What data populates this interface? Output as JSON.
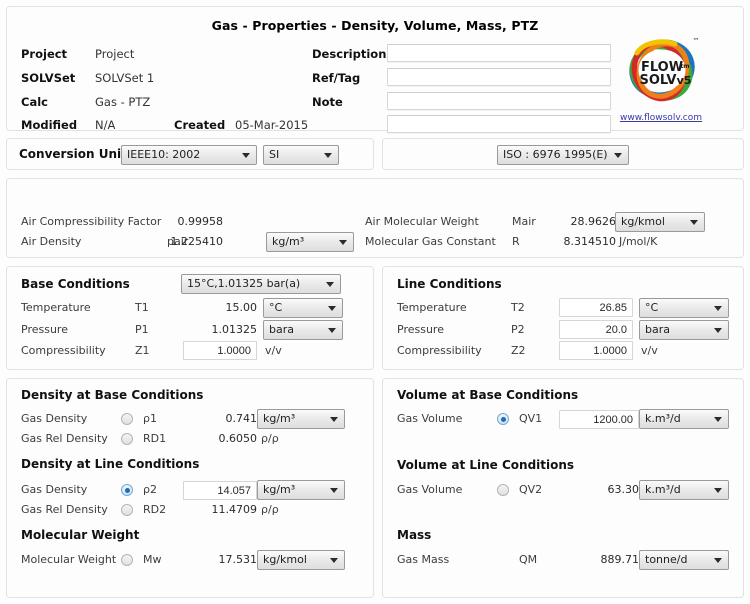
{
  "header": {
    "title": "Gas - Properties - Density, Volume, Mass, PTZ",
    "fields": [
      {
        "label": "Project",
        "value": "Project"
      },
      {
        "label": "SOLVSet",
        "value": "SOLVSet 1"
      },
      {
        "label": "Calc",
        "value": "Gas - PTZ"
      },
      {
        "label": "Modified",
        "value": "N/A"
      }
    ],
    "created_label": "Created",
    "created_value": "05-Mar-2015",
    "right_fields": [
      {
        "label": "Description",
        "value": "",
        "placeholder": ""
      },
      {
        "label": "Ref/Tag",
        "value": "",
        "placeholder": ""
      },
      {
        "label": "Note",
        "value": "",
        "placeholder": ""
      },
      {
        "label": "",
        "value": "",
        "placeholder": ""
      }
    ]
  },
  "logo": {
    "line1": "FLOW",
    "tm1": "tm",
    "line2": "SOLV",
    "version": "v5",
    "tm_mark": "™",
    "url": "www.flowsolv.com",
    "colors": {
      "blue": "#1b75bb",
      "green": "#3aa93a",
      "red": "#d62828",
      "orange": "#ef7f1a",
      "yellow": "#f2c400"
    }
  },
  "conversion": {
    "title": "Conversion Unit",
    "standard": "IEEE10: 2002",
    "system": "SI",
    "iso": "ISO : 6976 1995(E)"
  },
  "air": {
    "rows": [
      {
        "label": "Air Compressibility Factor",
        "symbol": "",
        "value": "0.99958",
        "unit": "",
        "unit_is_dropdown": false
      },
      {
        "label": "Air Density",
        "symbol": "pair",
        "value": "1.225410",
        "unit": "kg/m³",
        "unit_is_dropdown": true
      }
    ],
    "rows_right": [
      {
        "label": "Air Molecular Weight",
        "symbol": "Mair",
        "value": "28.9626",
        "unit": "kg/kmol",
        "unit_is_dropdown": true
      },
      {
        "label": "Molecular Gas Constant",
        "symbol": "R",
        "value": "8.314510",
        "unit": "J/mol/K",
        "unit_is_dropdown": false
      }
    ]
  },
  "base_conditions": {
    "title": "Base Conditions",
    "preset": "15°C,1.01325 bar(a)",
    "rows": [
      {
        "label": "Temperature",
        "symbol": "T1",
        "value": "15.00",
        "unit": "°C",
        "unit_is_dropdown": true,
        "editable": false
      },
      {
        "label": "Pressure",
        "symbol": "P1",
        "value": "1.01325",
        "unit": "bara",
        "unit_is_dropdown": true,
        "editable": false
      },
      {
        "label": "Compressibility",
        "symbol": "Z1",
        "value": "1.0000",
        "unit": "v/v",
        "unit_is_dropdown": false,
        "editable": true
      }
    ]
  },
  "line_conditions": {
    "title": "Line Conditions",
    "rows": [
      {
        "label": "Temperature",
        "symbol": "T2",
        "value": "26.85",
        "unit": "°C",
        "unit_is_dropdown": true,
        "editable": true
      },
      {
        "label": "Pressure",
        "symbol": "P2",
        "value": "20.0",
        "unit": "bara",
        "unit_is_dropdown": true,
        "editable": true
      },
      {
        "label": "Compressibility",
        "symbol": "Z2",
        "value": "1.0000",
        "unit": "v/v",
        "unit_is_dropdown": false,
        "editable": true
      }
    ]
  },
  "density_base": {
    "title": "Density at Base Conditions",
    "rows": [
      {
        "label": "Gas Density",
        "symbol": "ρ1",
        "value": "0.741",
        "unit": "kg/m³",
        "unit_is_dropdown": true,
        "editable": false,
        "radio": true,
        "selected": false
      },
      {
        "label": "Gas Rel Density",
        "symbol": "RD1",
        "value": "0.6050",
        "unit": "ρ/ρ",
        "unit_is_dropdown": false,
        "editable": false,
        "radio": true,
        "selected": false
      }
    ]
  },
  "density_line": {
    "title": "Density at Line Conditions",
    "rows": [
      {
        "label": "Gas Density",
        "symbol": "ρ2",
        "value": "14.057",
        "unit": "kg/m³",
        "unit_is_dropdown": true,
        "editable": true,
        "radio": true,
        "selected": true
      },
      {
        "label": "Gas Rel Density",
        "symbol": "RD2",
        "value": "11.4709",
        "unit": "ρ/ρ",
        "unit_is_dropdown": false,
        "editable": false,
        "radio": true,
        "selected": false
      }
    ]
  },
  "molecular_weight": {
    "title": "Molecular Weight",
    "rows": [
      {
        "label": "Molecular Weight",
        "symbol": "Mw",
        "value": "17.531",
        "unit": "kg/kmol",
        "unit_is_dropdown": true,
        "editable": false,
        "radio": true,
        "selected": false
      }
    ]
  },
  "volume_base": {
    "title": "Volume at Base Conditions",
    "rows": [
      {
        "label": "Gas Volume",
        "symbol": "QV1",
        "value": "1200.00",
        "unit": "k.m³/d",
        "unit_is_dropdown": true,
        "editable": true,
        "radio": true,
        "selected": true
      }
    ]
  },
  "volume_line": {
    "title": "Volume at Line Conditions",
    "rows": [
      {
        "label": "Gas Volume",
        "symbol": "QV2",
        "value": "63.30",
        "unit": "k.m³/d",
        "unit_is_dropdown": true,
        "editable": false,
        "radio": true,
        "selected": false
      }
    ]
  },
  "mass": {
    "title": "Mass",
    "rows": [
      {
        "label": "Gas Mass",
        "symbol": "QM",
        "value": "889.71",
        "unit": "tonne/d",
        "unit_is_dropdown": true,
        "editable": false,
        "radio": false,
        "selected": false
      }
    ]
  }
}
